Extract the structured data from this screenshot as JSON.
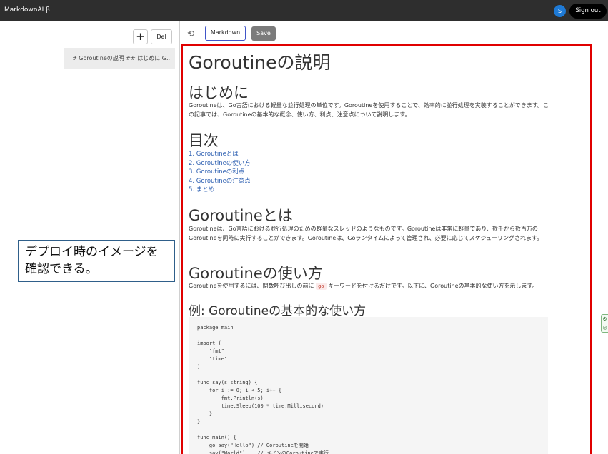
{
  "header": {
    "app_title": "MarkdownAI β",
    "avatar_initial": "S",
    "signout_label": "Sign out"
  },
  "sidebar": {
    "add_label": "+",
    "del_label": "Del",
    "documents": [
      {
        "label": "# Goroutineの説明 ## はじめに G..."
      }
    ]
  },
  "callout": {
    "text": "デプロイ時のイメージを確認できる。"
  },
  "toolbar": {
    "undo_icon": "undo-icon",
    "markdown_label": "Markdown",
    "save_label": "Save"
  },
  "preview": {
    "title": "Goroutineの説明",
    "intro_heading": "はじめに",
    "intro_text": "Goroutineは、Go言語における軽量な並行処理の単位です。Goroutineを使用することで、効率的に並行処理を実装することができます。この記事では、Goroutineの基本的な概念、使い方、利点、注意点について説明します。",
    "toc_heading": "目次",
    "toc": [
      "1. Goroutineとは",
      "2. Goroutineの使い方",
      "3. Goroutineの利点",
      "4. Goroutineの注意点",
      "5. まとめ"
    ],
    "section1_heading": "Goroutineとは",
    "section1_text": "Goroutineは、Go言語における並行処理のための軽量なスレッドのようなものです。Goroutineは非常に軽量であり、数千から数百万のGoroutineを同時に実行することができます。Goroutineは、Goランタイムによって管理され、必要に応じてスケジューリングされます。",
    "section2_heading": "Goroutineの使い方",
    "section2_text_before": "Goroutineを使用するには、関数呼び出しの前に",
    "section2_inline_code": "go",
    "section2_text_after": "キーワードを付けるだけです。以下に、Goroutineの基本的な使い方を示します。",
    "example_heading": "例: Goroutineの基本的な使い方",
    "code": "package main\n\nimport (\n    \"fmt\"\n    \"time\"\n)\n\nfunc say(s string) {\n    for i := 0; i < 5; i++ {\n        fmt.Println(s)\n        time.Sleep(100 * time.Millisecond)\n    }\n}\n\nfunc main() {\n    go say(\"Hello\") // Goroutineを開始\n    say(\"World\")    // メインのGoroutineで実行"
  },
  "colors": {
    "topbar": "#2e2e2e",
    "preview_border": "#e00000",
    "markdown_border": "#4054c8",
    "link": "#2a5db0",
    "avatar": "#1e7ad6"
  }
}
